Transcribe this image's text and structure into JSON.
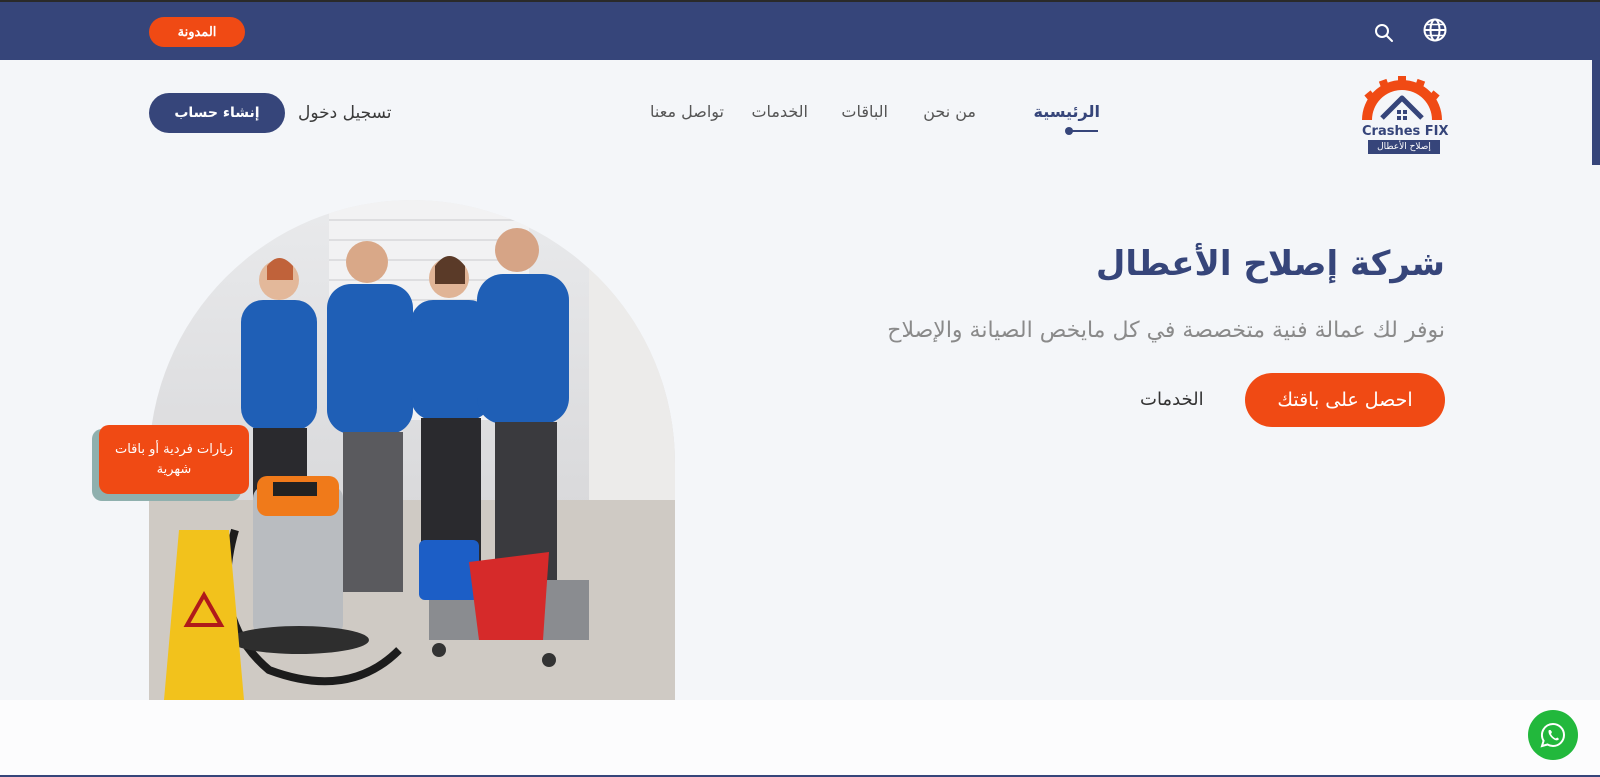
{
  "topbar": {
    "blog_label": "المدونة",
    "search_icon": "search-icon",
    "globe_icon": "globe-icon"
  },
  "nav": {
    "signup_label": "إنشاء حساب",
    "login_label": "تسجيل دخول",
    "links": [
      {
        "label": "الرئيسية",
        "active": true
      },
      {
        "label": "من نحن"
      },
      {
        "label": "الباقات"
      },
      {
        "label": "الخدمات"
      },
      {
        "label": "تواصل معنا"
      }
    ]
  },
  "logo": {
    "name": "Crashes FIX",
    "subtitle": "إصلاح الأعطال"
  },
  "hero": {
    "title": "شركة إصلاح الأعطال",
    "subtitle": "نوفر لك عمالة فنية متخصصة في كل مايخص الصيانة والإصلاح",
    "cta_label": "احصل على باقتك",
    "services_label": "الخدمات",
    "badge_text": "زيارات فردية أو باقات شهرية"
  },
  "colors": {
    "primary": "#36457a",
    "accent": "#f04a14",
    "whatsapp": "#22b83c"
  }
}
